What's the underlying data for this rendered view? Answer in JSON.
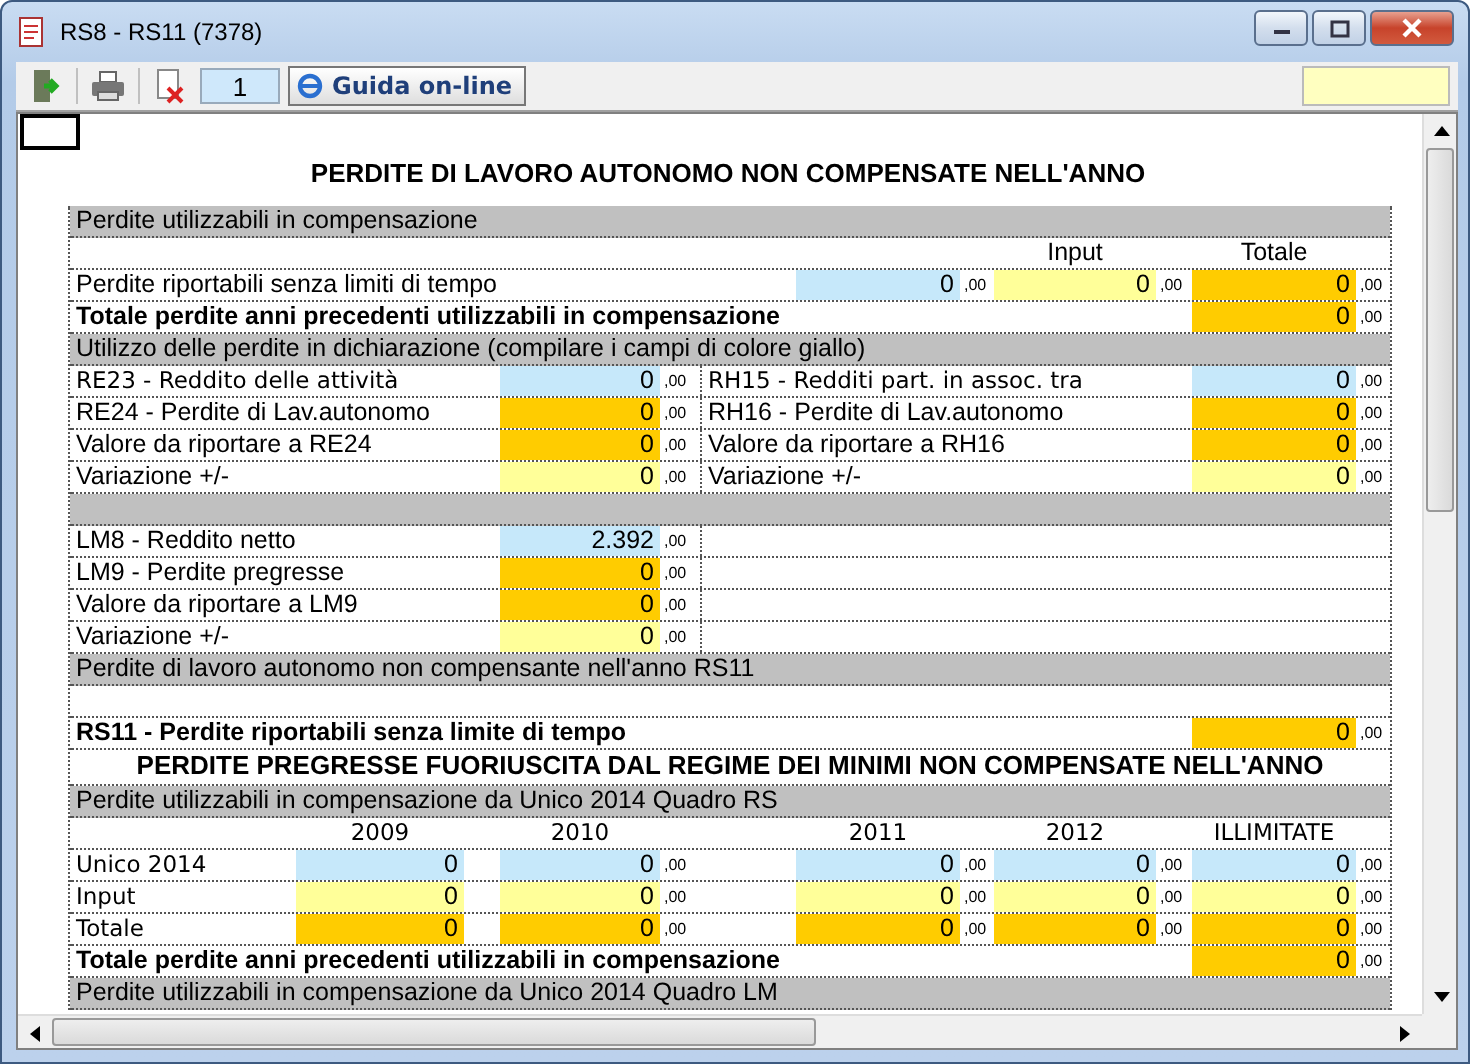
{
  "window": {
    "title": "RS8 - RS11 (7378)"
  },
  "toolbar": {
    "page": "1",
    "help_button": "Guida on-line"
  },
  "sheet": {
    "title": "PERDITE DI LAVORO AUTONOMO NON COMPENSATE NELL'ANNO",
    "rows": [
      {
        "kind": "band",
        "text": "Perdite utilizzabili in compensazione"
      },
      {
        "kind": "heads",
        "texts": [
          "Input",
          "Totale"
        ]
      },
      {
        "kind": "triple",
        "label": "Perdite riportabili senza limiti di tempo",
        "values": [
          {
            "value": "0",
            "decimals": ",00",
            "color": "#c6e8fa"
          },
          {
            "value": "0",
            "decimals": ",00",
            "color": "#ffff99"
          },
          {
            "value": "0",
            "decimals": ",00",
            "color": "#ffcc00"
          }
        ]
      },
      {
        "kind": "total",
        "label": "Totale perdite anni precedenti  utilizzabili in compensazione",
        "value": {
          "value": "0",
          "decimals": ",00",
          "color": "#ffcc00"
        }
      },
      {
        "kind": "band",
        "text": "Utilizzo delle perdite in dichiarazione (compilare i campi di colore giallo)"
      },
      {
        "kind": "pair",
        "left": {
          "label": "RE23 - Reddito delle attività",
          "value": "0",
          "decimals": ",00",
          "color": "#c6e8fa"
        },
        "right": {
          "label": "RH15 - Redditi  part. in assoc. tra",
          "value": "0",
          "decimals": ",00",
          "color": "#c6e8fa"
        }
      },
      {
        "kind": "pair",
        "left": {
          "label": "RE24 - Perdite di Lav.autonomo",
          "value": "0",
          "decimals": ",00",
          "color": "#ffcc00"
        },
        "right": {
          "label": "RH16 - Perdite di Lav.autonomo",
          "value": "0",
          "decimals": ",00",
          "color": "#ffcc00"
        }
      },
      {
        "kind": "pair",
        "left": {
          "label": "Valore da riportare a RE24",
          "value": "0",
          "decimals": ",00",
          "color": "#ffcc00"
        },
        "right": {
          "label": "Valore da riportare a RH16",
          "value": "0",
          "decimals": ",00",
          "color": "#ffcc00"
        }
      },
      {
        "kind": "pair",
        "left": {
          "label": "Variazione +/-",
          "value": "0",
          "decimals": ",00",
          "color": "#ffff99"
        },
        "right": {
          "label": "Variazione +/-",
          "value": "0",
          "decimals": ",00",
          "color": "#ffff99"
        }
      },
      {
        "kind": "band"
      },
      {
        "kind": "pair",
        "left": {
          "label": "LM8 - Reddito netto",
          "value": "2.392",
          "decimals": ",00",
          "color": "#c6e8fa"
        }
      },
      {
        "kind": "pair",
        "left": {
          "label": "LM9 - Perdite pregresse",
          "value": "0",
          "decimals": ",00",
          "color": "#ffcc00"
        }
      },
      {
        "kind": "pair",
        "left": {
          "label": "Valore da riportare a LM9",
          "value": "0",
          "decimals": ",00",
          "color": "#ffcc00"
        }
      },
      {
        "kind": "pair",
        "left": {
          "label": "Variazione +/-",
          "value": "0",
          "decimals": ",00",
          "color": "#ffff99"
        }
      },
      {
        "kind": "band",
        "text": "Perdite di lavoro autonomo non compensante nell'anno RS11"
      },
      {
        "kind": "blank"
      },
      {
        "kind": "total",
        "label": "RS11 - Perdite riportabili senza limite di tempo",
        "value": {
          "value": "0",
          "decimals": ",00",
          "color": "#ffcc00"
        }
      },
      {
        "kind": "title",
        "text": "PERDITE PREGRESSE FUORIUSCITA DAL REGIME DEI MINIMI NON COMPENSATE NELL'ANNO"
      },
      {
        "kind": "band",
        "text": "Perdite utilizzabili in compensazione da Unico 2014 Quadro RS"
      },
      {
        "kind": "years",
        "texts": [
          "2009",
          "2010",
          "2011",
          "2012",
          "ILLIMITATE"
        ]
      },
      {
        "kind": "year_values",
        "label": "Unico 2014",
        "values": [
          {
            "value": "0",
            "color": "#c6e8fa"
          },
          {
            "value": "0",
            "decimals": ",00",
            "color": "#c6e8fa"
          },
          {
            "value": "0",
            "decimals": ",00",
            "color": "#c6e8fa"
          },
          {
            "value": "0",
            "decimals": ",00",
            "color": "#c6e8fa"
          },
          {
            "value": "0",
            "decimals": ",00",
            "color": "#c6e8fa"
          }
        ]
      },
      {
        "kind": "year_values",
        "label": "Input",
        "values": [
          {
            "value": "0",
            "color": "#ffff99"
          },
          {
            "value": "0",
            "decimals": ",00",
            "color": "#ffff99"
          },
          {
            "value": "0",
            "decimals": ",00",
            "color": "#ffff99"
          },
          {
            "value": "0",
            "decimals": ",00",
            "color": "#ffff99"
          },
          {
            "value": "0",
            "decimals": ",00",
            "color": "#ffff99"
          }
        ]
      },
      {
        "kind": "year_values",
        "label": "Totale",
        "values": [
          {
            "value": "0",
            "color": "#ffcc00"
          },
          {
            "value": "0",
            "decimals": ",00",
            "color": "#ffcc00"
          },
          {
            "value": "0",
            "decimals": ",00",
            "color": "#ffcc00"
          },
          {
            "value": "0",
            "decimals": ",00",
            "color": "#ffcc00"
          },
          {
            "value": "0",
            "decimals": ",00",
            "color": "#ffcc00"
          }
        ]
      },
      {
        "kind": "total",
        "label": "Totale perdite anni precedenti  utilizzabili in compensazione",
        "value": {
          "value": "0",
          "decimals": ",00",
          "color": "#ffcc00"
        }
      },
      {
        "kind": "band",
        "text": "Perdite utilizzabili in compensazione da Unico 2014 Quadro LM"
      }
    ]
  }
}
